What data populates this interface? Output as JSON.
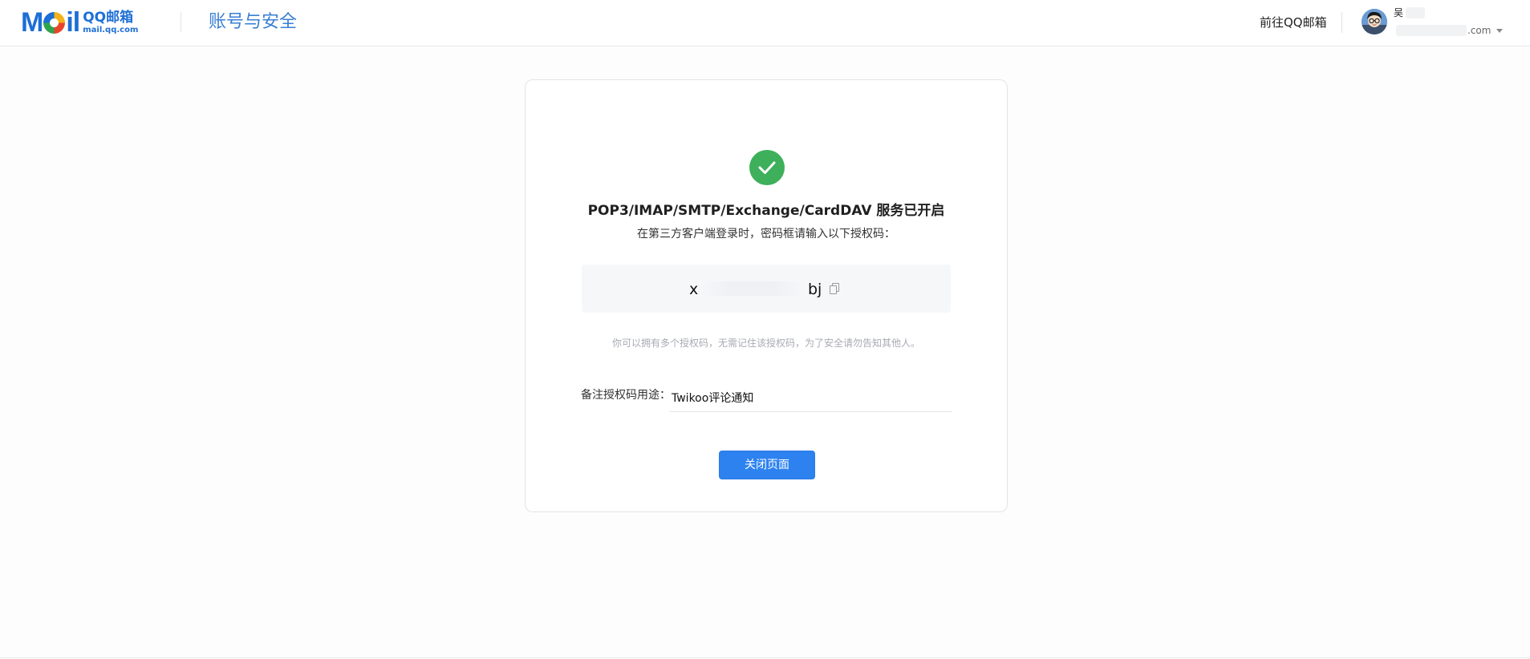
{
  "header": {
    "logo_mail": "M",
    "logo_tail": "il",
    "logo_brand": "QQ邮箱",
    "logo_domain": "mail.qq.com",
    "page_title": "账号与安全",
    "goto_link": "前往QQ邮箱",
    "user_name": "吴",
    "user_email_suffix": ".com"
  },
  "card": {
    "heading": "POP3/IMAP/SMTP/Exchange/CardDAV 服务已开启",
    "subtext": "在第三方客户端登录时，密码框请输入以下授权码：",
    "code_start": "x",
    "code_end": "bj",
    "hint": "你可以拥有多个授权码，无需记住该授权码，为了安全请勿告知其他人。",
    "remark_label": "备注授权码用途：",
    "remark_value": "Twikoo评论通知",
    "close_button": "关闭页面"
  },
  "icons": {
    "check": "check-circle-icon",
    "copy": "copy-icon",
    "caret": "caret-down-icon"
  },
  "colors": {
    "brand_blue": "#1d6fd6",
    "title_blue": "#3a7fd4",
    "success_green": "#3eb05b",
    "button_blue": "#2d82f0"
  }
}
